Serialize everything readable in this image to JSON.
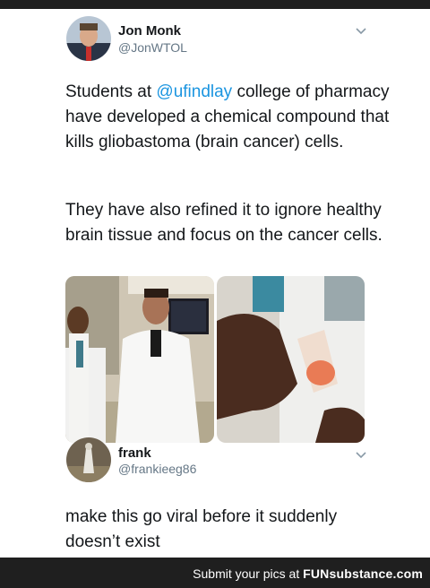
{
  "tweet": {
    "author_name": "Jon Monk",
    "author_handle": "@JonWTOL",
    "paragraph1_mention": "@ufindlay",
    "paragraph1_before": "Students at ",
    "paragraph1_after": " college of pharmacy have developed a chemical compound that kills gliobastoma (brain cancer) cells.",
    "paragraph2": "They have also refined it to ignore healthy brain tissue and focus on the cancer cells."
  },
  "reply": {
    "author_name": "frank",
    "author_handle": "@frankieeg86",
    "text": "make this go viral before it suddenly doesn’t exist"
  },
  "footer": {
    "prefix": "Submit your pics at ",
    "brand": "FUNsubstance.com"
  },
  "icons": {
    "menu": "chevron-down-icon"
  },
  "colors": {
    "mention": "#1b95e0",
    "background": "#1f1f1f"
  }
}
